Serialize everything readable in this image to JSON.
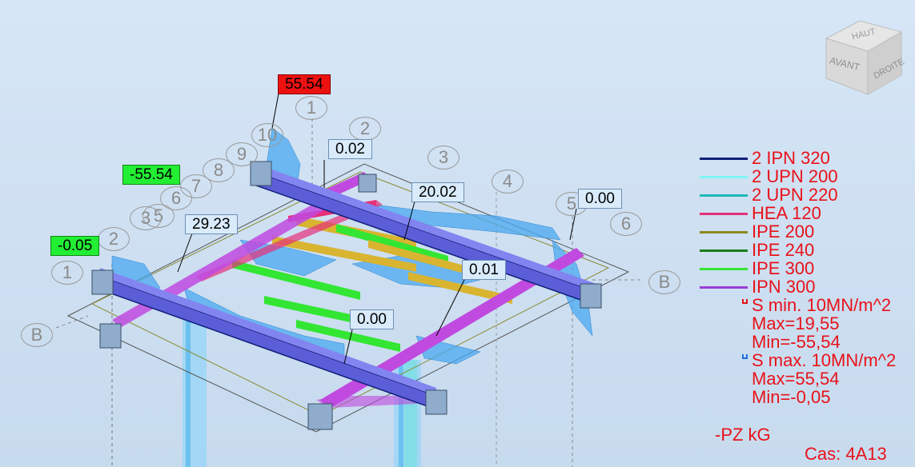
{
  "viewcube": {
    "top": "HAUT",
    "front": "AVANT",
    "right": "DROITE"
  },
  "value_labels": [
    {
      "text": "55.54",
      "style": "red"
    },
    {
      "text": "-55.54",
      "style": "green"
    },
    {
      "text": "-0.05",
      "style": "green"
    },
    {
      "text": "0.02",
      "style": "plain"
    },
    {
      "text": "20.02",
      "style": "plain"
    },
    {
      "text": "29.23",
      "style": "plain"
    },
    {
      "text": "0.00",
      "style": "plain"
    },
    {
      "text": "0.01",
      "style": "plain"
    },
    {
      "text": "0.00",
      "style": "plain"
    }
  ],
  "axis_labels": [
    "1",
    "2",
    "3",
    "4",
    "5",
    "6",
    "10",
    "9",
    "8",
    "7",
    "6",
    "5",
    "3",
    "2",
    "1",
    "B",
    "B"
  ],
  "legend": {
    "sections": [
      {
        "label": "2 IPN 320",
        "color": "#10207a"
      },
      {
        "label": "2 UPN 200",
        "color": "#7ff3f3"
      },
      {
        "label": "2 UPN 220",
        "color": "#1fb8b8"
      },
      {
        "label": "HEA 120",
        "color": "#e6307a"
      },
      {
        "label": "IPE 200",
        "color": "#8b8a1e"
      },
      {
        "label": "IPE 240",
        "color": "#1a7d1a"
      },
      {
        "label": "IPE 300",
        "color": "#33e633"
      },
      {
        "label": "IPN 300",
        "color": "#9b3bd6"
      }
    ],
    "stress_min": {
      "label": "S min. 10MN/m^2",
      "max": "Max=19,55",
      "min": "Min=-55,54",
      "marker_color": "#e8121a"
    },
    "stress_max": {
      "label": "S max. 10MN/m^2",
      "max": "Max=55,54",
      "min": "Min=-0,05",
      "marker_color": "#1f6fe0"
    }
  },
  "load_label": "-PZ kG",
  "case_label": "Cas: 4A13",
  "colors": {
    "background": "#d6e6f6",
    "diagram": "#5aaef0",
    "legend_text": "#e8121a"
  }
}
